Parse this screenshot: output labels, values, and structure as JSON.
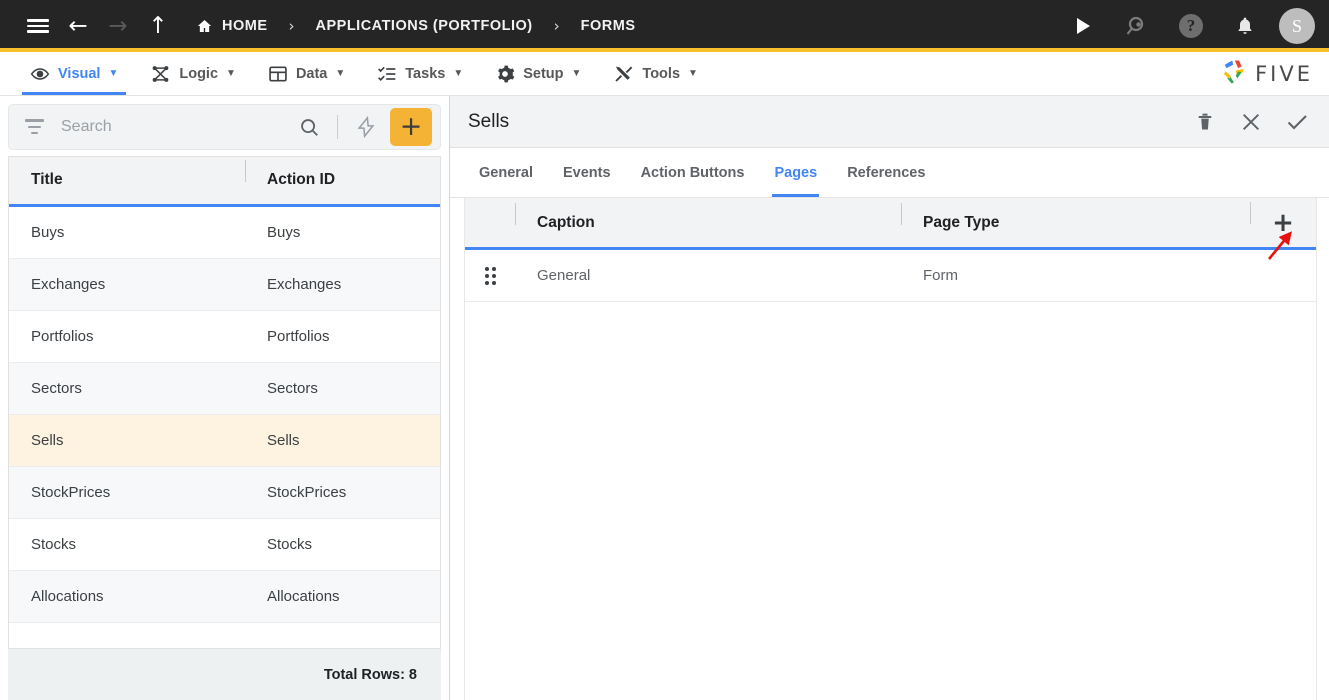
{
  "topbar": {
    "menu_icon": "hamburger-icon",
    "back_icon": "arrow-left-icon",
    "forward_icon": "arrow-right-icon",
    "up_icon": "arrow-up-icon",
    "breadcrumbs": [
      {
        "label": "HOME",
        "icon": "home-icon"
      },
      {
        "label": "APPLICATIONS (PORTFOLIO)",
        "icon": ""
      },
      {
        "label": "FORMS",
        "icon": ""
      }
    ],
    "separator": "›",
    "actions": [
      {
        "name": "run-icon",
        "label": ""
      },
      {
        "name": "search-icon",
        "label": ""
      },
      {
        "name": "help-icon",
        "label": "?"
      },
      {
        "name": "notifications-bell-icon",
        "label": ""
      }
    ],
    "avatar_initial": "S",
    "accent_color": "#F8C12C",
    "background_color": "#252525"
  },
  "menubar": {
    "items": [
      {
        "label": "Visual",
        "icon": "eye-icon",
        "active": true
      },
      {
        "label": "Logic",
        "icon": "logic-graph-icon",
        "active": false
      },
      {
        "label": "Data",
        "icon": "table-grid-icon",
        "active": false
      },
      {
        "label": "Tasks",
        "icon": "checklist-icon",
        "active": false
      },
      {
        "label": "Setup",
        "icon": "gear-icon",
        "active": false
      },
      {
        "label": "Tools",
        "icon": "tools-icon",
        "active": false
      }
    ],
    "caret": "▼",
    "brand": "FIVE",
    "active_color": "#4285F4"
  },
  "sidebar": {
    "search": {
      "placeholder": "Search",
      "value": ""
    },
    "filter_icon": "filter-icon",
    "search_icon": "magnifier-icon",
    "lightning_icon": "lightning-bolt-icon",
    "add_label": "+",
    "columns": [
      "Title",
      "Action ID"
    ],
    "rows": [
      {
        "title": "Buys",
        "action_id": "Buys",
        "selected": false
      },
      {
        "title": "Exchanges",
        "action_id": "Exchanges",
        "selected": false
      },
      {
        "title": "Portfolios",
        "action_id": "Portfolios",
        "selected": false
      },
      {
        "title": "Sectors",
        "action_id": "Sectors",
        "selected": false
      },
      {
        "title": "Sells",
        "action_id": "Sells",
        "selected": true
      },
      {
        "title": "StockPrices",
        "action_id": "StockPrices",
        "selected": false
      },
      {
        "title": "Stocks",
        "action_id": "Stocks",
        "selected": false
      },
      {
        "title": "Allocations",
        "action_id": "Allocations",
        "selected": false
      }
    ],
    "footer": "Total Rows: 8",
    "selected_row_color": "#FDF3E0"
  },
  "detail": {
    "title": "Sells",
    "header_actions": [
      {
        "name": "delete-icon",
        "label": ""
      },
      {
        "name": "close-icon",
        "label": ""
      },
      {
        "name": "save-check-icon",
        "label": ""
      }
    ],
    "tabs": [
      {
        "label": "General",
        "active": false
      },
      {
        "label": "Events",
        "active": false
      },
      {
        "label": "Action Buttons",
        "active": false
      },
      {
        "label": "Pages",
        "active": true
      },
      {
        "label": "References",
        "active": false
      }
    ],
    "pages_grid": {
      "columns": [
        "Caption",
        "Page Type"
      ],
      "add_label": "+",
      "rows": [
        {
          "caption": "General",
          "page_type": "Form"
        }
      ]
    }
  },
  "annotation": {
    "arrow_color": "#e8110f",
    "points_to": "add-page-button"
  }
}
